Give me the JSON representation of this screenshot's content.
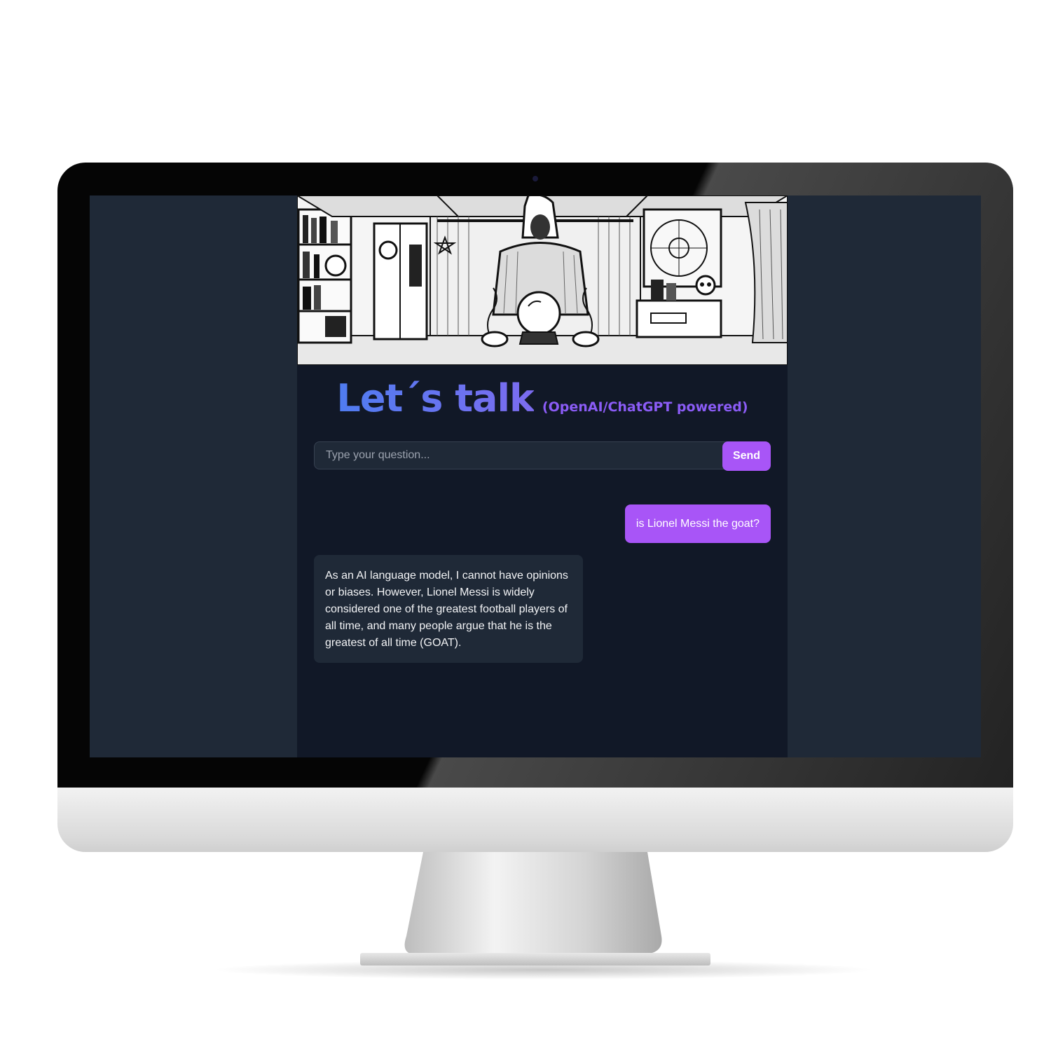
{
  "app": {
    "title": "Let´s talk",
    "subtitle": "(OpenAI/ChatGPT powered)",
    "hero_image": "fortune-teller-crystal-ball-illustration"
  },
  "input": {
    "placeholder": "Type your question...",
    "value": ""
  },
  "send_button": {
    "label": "Send"
  },
  "messages": [
    {
      "role": "user",
      "text": "is Lionel Messi the goat?"
    },
    {
      "role": "assistant",
      "text": "As an AI language model, I cannot have opinions or biases. However, Lionel Messi is widely considered one of the greatest football players of all time, and many people argue that he is the greatest of all time (GOAT)."
    }
  ],
  "colors": {
    "page_bg": "#1f2937",
    "panel_bg": "#111827",
    "accent_purple": "#a855f7",
    "title_blue": "#5b6ef0",
    "subtitle_purple": "#8b5cf6",
    "bubble_ai": "#1f2937"
  }
}
